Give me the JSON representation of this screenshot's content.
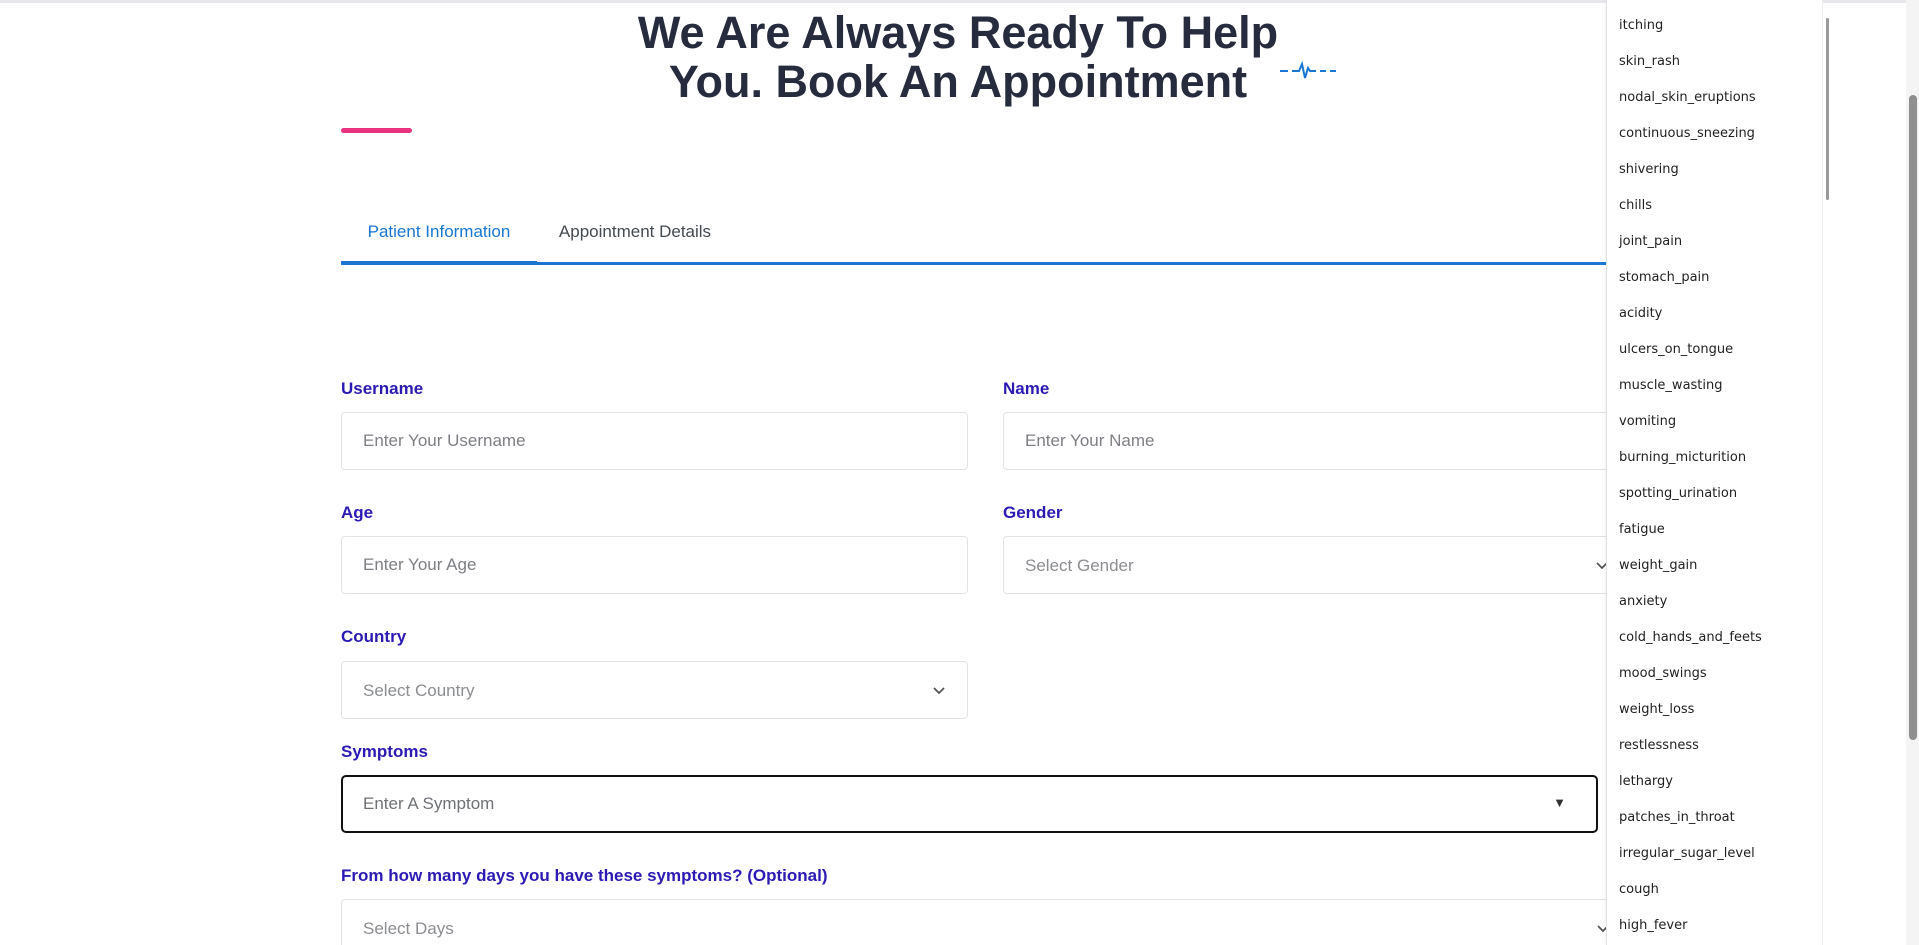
{
  "page": {
    "heading": "We Are Always Ready To Help You. Book An Appointment"
  },
  "tabs": [
    {
      "label": "Patient Information",
      "active": true
    },
    {
      "label": "Appointment Details",
      "active": false
    }
  ],
  "form": {
    "username": {
      "label": "Username",
      "placeholder": "Enter Your Username",
      "value": ""
    },
    "name": {
      "label": "Name",
      "placeholder": "Enter Your Name",
      "value": ""
    },
    "age": {
      "label": "Age",
      "placeholder": "Enter Your Age",
      "value": ""
    },
    "gender": {
      "label": "Gender",
      "selected": "Select Gender"
    },
    "country": {
      "label": "Country",
      "selected": "Select Country"
    },
    "symptoms": {
      "label": "Symptoms",
      "placeholder": "Enter A Symptom",
      "value": ""
    },
    "days": {
      "label": "From how many days you have these symptoms? (Optional)",
      "selected": "Select Days"
    }
  },
  "symptom_options": [
    "itching",
    "skin_rash",
    "nodal_skin_eruptions",
    "continuous_sneezing",
    "shivering",
    "chills",
    "joint_pain",
    "stomach_pain",
    "acidity",
    "ulcers_on_tongue",
    "muscle_wasting",
    "vomiting",
    "burning_micturition",
    "spotting_urination",
    "fatigue",
    "weight_gain",
    "anxiety",
    "cold_hands_and_feets",
    "mood_swings",
    "weight_loss",
    "restlessness",
    "lethargy",
    "patches_in_throat",
    "irregular_sugar_level",
    "cough",
    "high_fever"
  ],
  "colors": {
    "accent": "#1976d2",
    "label": "#2b1ab3",
    "underline": "#e9337e",
    "heading": "#262b3d"
  },
  "icons": {
    "heartbeat": "pulse-line-icon",
    "select": "chevron-down-icon",
    "combobox": "caret-down-icon"
  }
}
